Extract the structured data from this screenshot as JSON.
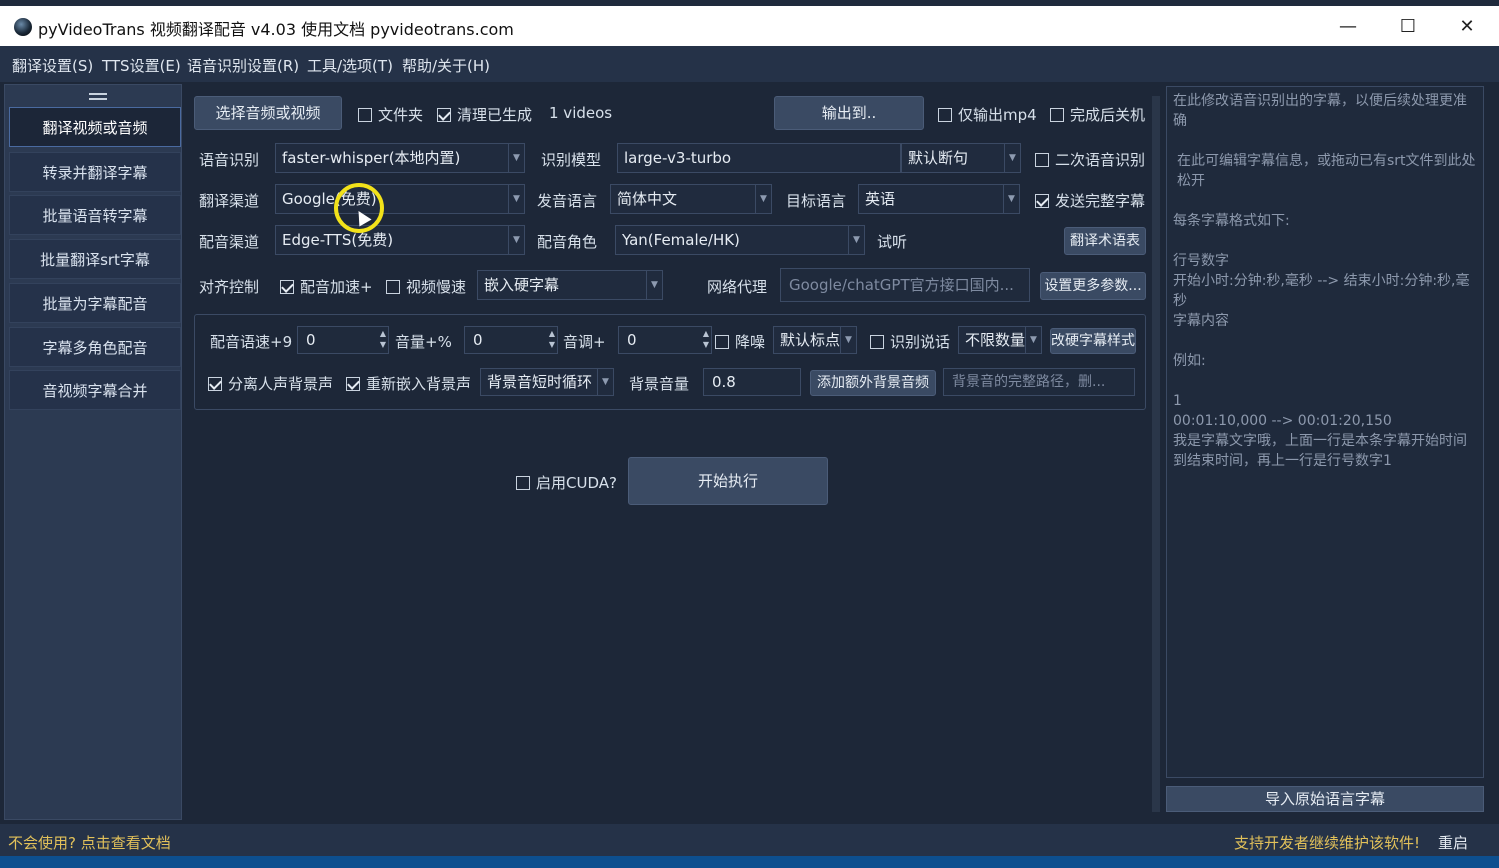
{
  "window": {
    "title": "pyVideoTrans 视频翻译配音 v4.03 使用文档 pyvideotrans.com",
    "minimize_glyph": "—",
    "maximize_glyph": "☐",
    "close_glyph": "✕"
  },
  "menu": [
    "翻译设置(S)",
    "TTS设置(E)",
    "语音识别设置(R)",
    "工具/选项(T)",
    "帮助/关于(H)"
  ],
  "nav": {
    "items": [
      "翻译视频或音频",
      "转录并翻译字幕",
      "批量语音转字幕",
      "批量翻译srt字幕",
      "批量为字幕配音",
      "字幕多角色配音",
      "音视频字幕合并"
    ],
    "active_index": 0
  },
  "toolbar": {
    "select_media": "选择音频或视频",
    "folder_label": "文件夹",
    "folder_checked": false,
    "cleanup_label": "清理已生成",
    "cleanup_checked": true,
    "videos_count": "1 videos",
    "output_to": "输出到..",
    "only_mp4_label": "仅输出mp4",
    "only_mp4_checked": false,
    "shutdown_label": "完成后关机",
    "shutdown_checked": false
  },
  "row_asr": {
    "label": "语音识别",
    "value": "faster-whisper(本地内置)",
    "model_label": "识别模型",
    "model_value": "large-v3-turbo",
    "split_value": "默认断句",
    "second_asr_label": "二次语音识别",
    "second_asr_checked": false
  },
  "row_translate": {
    "label": "翻译渠道",
    "value": "Google(免费)",
    "source_label": "发音语言",
    "source_value": "简体中文",
    "target_label": "目标语言",
    "target_value": "英语",
    "send_full_label": "发送完整字幕",
    "send_full_checked": true
  },
  "row_dub": {
    "label": "配音渠道",
    "value": "Edge-TTS(免费)",
    "role_label": "配音角色",
    "role_value": "Yan(Female/HK)",
    "listen_label": "试听",
    "glossary_button": "翻译术语表"
  },
  "row_align": {
    "label": "对齐控制",
    "dub_speed_label": "配音加速+",
    "dub_speed_checked": true,
    "video_slow_label": "视频慢速",
    "video_slow_checked": false,
    "subtitle_mode": "嵌入硬字幕",
    "proxy_label": "网络代理",
    "proxy_placeholder": "Google/chatGPT官方接口国内...",
    "more_params_button": "设置更多参数..."
  },
  "group": {
    "rate_label": "配音语速+9",
    "rate_value": "0",
    "volume_label": "音量+%",
    "volume_value": "0",
    "pitch_label": "音调+",
    "pitch_value": "0",
    "denoise_label": "降噪",
    "denoise_checked": false,
    "punct_value": "默认标点",
    "speaker_label": "识别说话",
    "speaker_checked": false,
    "speaker_count": "不限数量",
    "hard_sub_style_button": "改硬字幕样式",
    "separate_label": "分离人声背景声",
    "separate_checked": true,
    "reembed_label": "重新嵌入背景声",
    "reembed_checked": true,
    "bg_loop_value": "背景音短时循环",
    "bg_volume_label": "背景音量",
    "bg_volume_value": "0.8",
    "add_bg_button": "添加额外背景音频",
    "bg_path_placeholder": "背景音的完整路径，删..."
  },
  "run": {
    "cuda_label": "启用CUDA?",
    "cuda_checked": false,
    "start_button": "开始执行"
  },
  "right_panel": {
    "lines": [
      "在此修改语音识别出的字幕，以便后续处理更准确",
      "",
      "在此可编辑字幕信息，或拖动已有srt文件到此处松开",
      "",
      "每条字幕格式如下:",
      "",
      "行号数字",
      "开始小时:分钟:秒,毫秒 --> 结束小时:分钟:秒,毫秒",
      "字幕内容",
      "",
      "例如:",
      "",
      "1",
      "00:01:10,000 --> 00:01:20,150",
      "我是字幕文字哦，上面一行是本条字幕开始时间到结束时间，再上一行是行号数字1"
    ],
    "import_button": "导入原始语言字幕"
  },
  "status": {
    "help_link": "不会使用? 点击查看文档",
    "support_link": "支持开发者继续维护该软件!",
    "restart": "重启"
  },
  "colors": {
    "background": "#1d2738",
    "accent_border": "#4a6aa0",
    "status_text": "#e2c15a",
    "cursor_highlight": "#f2e21a"
  }
}
